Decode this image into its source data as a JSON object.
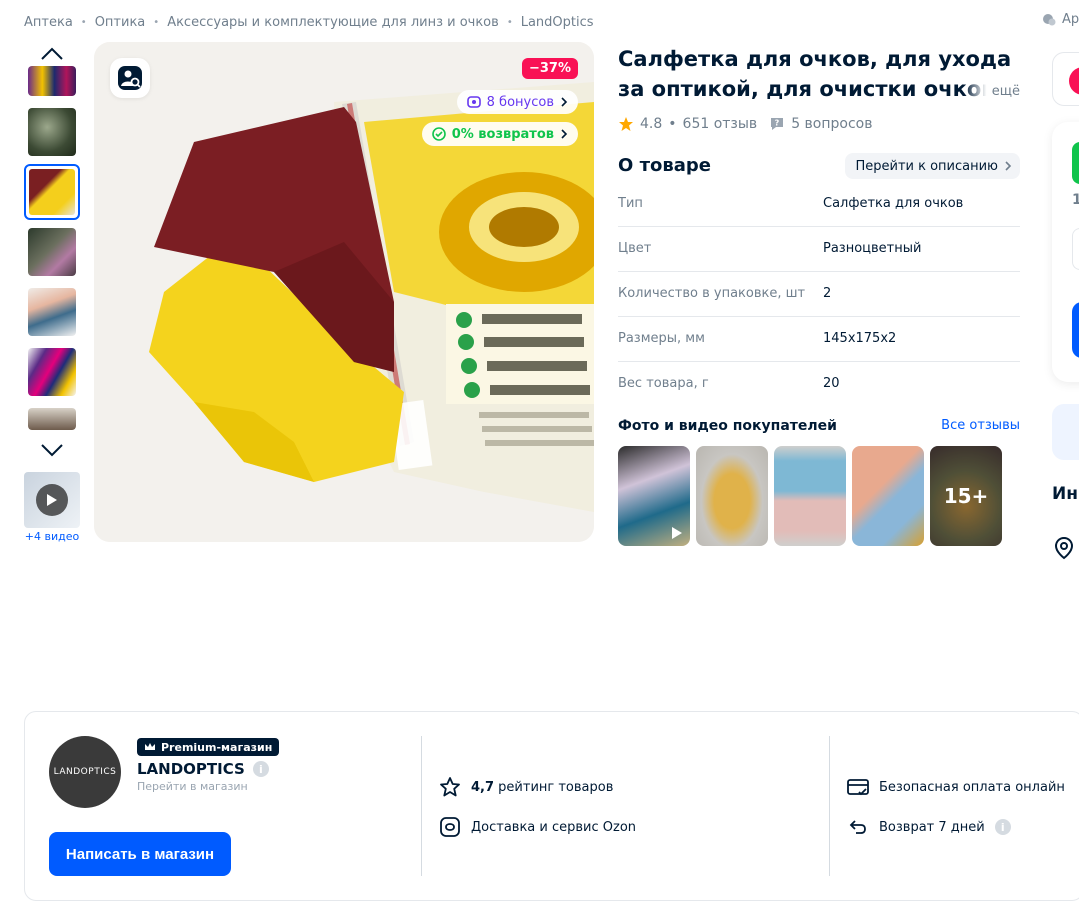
{
  "breadcrumbs": [
    "Аптека",
    "Оптика",
    "Аксессуары и комплектующие для линз и очков",
    "LandOptics"
  ],
  "breadcrumb_right": "Ар",
  "gallery": {
    "video_count": "+4 видео",
    "discount": "−37%",
    "bonus": "8 бонусов",
    "returns": "0% возвратов"
  },
  "product": {
    "title": "Салфетка для очков, для ухода за оптикой, для очистки очков, линз",
    "title_more": "ещё",
    "rating": "4.8",
    "reviews": "651 отзыв",
    "questions": "5 вопросов"
  },
  "about": {
    "title": "О товаре",
    "link": "Перейти к описанию",
    "specs": [
      {
        "key": "Тип",
        "value": "Салфетка для очков"
      },
      {
        "key": "Цвет",
        "value": "Разноцветный"
      },
      {
        "key": "Количество в упаковке, шт",
        "value": "2"
      },
      {
        "key": "Размеры, мм",
        "value": "145x175x2"
      },
      {
        "key": "Вес товара, г",
        "value": "20"
      }
    ]
  },
  "customer_photos": {
    "title": "Фото и видео покупателей",
    "link": "Все отзывы",
    "more": "15+"
  },
  "right_col": {
    "number_fragment": "1",
    "info_fragment": "Ин"
  },
  "seller": {
    "badge": "Premium-магазин",
    "name": "LANDOPTICS",
    "logo_text": "LANDOPTICS",
    "subtitle": "Перейти в магазин",
    "write_button": "Написать в магазин",
    "rating_value": "4,7",
    "rating_label": "рейтинг товаров",
    "delivery": "Доставка и сервис Ozon",
    "payment": "Безопасная оплата онлайн",
    "return": "Возврат 7 дней"
  },
  "colors": {
    "accent": "#005bff",
    "discount": "#f91155",
    "bonus": "#6637ef",
    "returns": "#10c44c",
    "star": "#ffa800"
  }
}
